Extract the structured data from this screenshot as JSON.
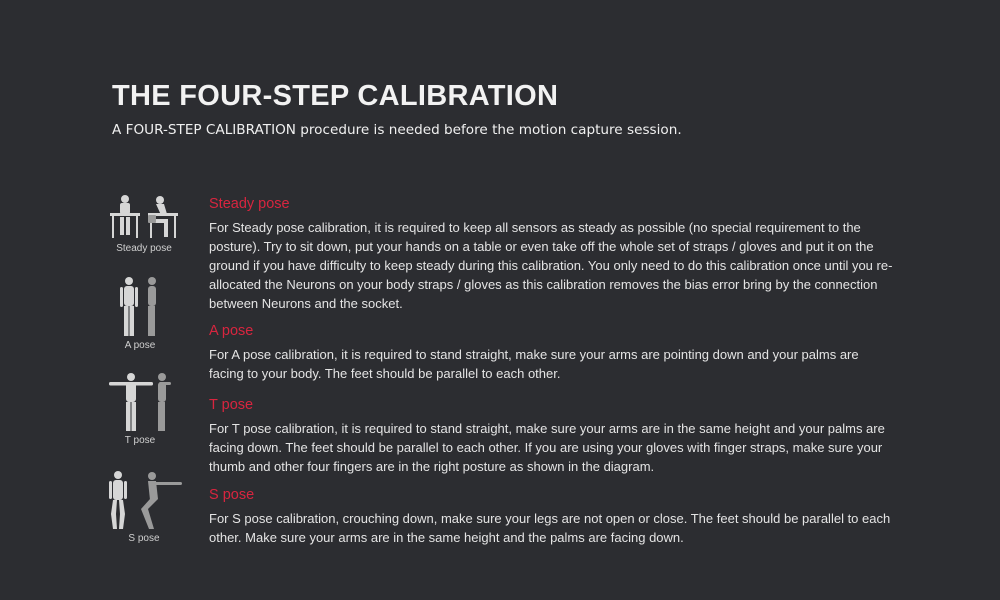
{
  "title": "THE FOUR-STEP CALIBRATION",
  "subtitle": "A FOUR-STEP CALIBRATION procedure is needed before the motion capture session.",
  "colors": {
    "background": "#2c2d31",
    "heading_accent": "#d8253f",
    "figure": "#c8c8c8"
  },
  "poses": [
    {
      "caption": "Steady pose",
      "heading": "Steady pose",
      "text": "For Steady pose calibration, it is required to keep all sensors as steady as possible (no special requirement to the posture). Try to sit down, put your hands on a table or even take off the whole set of straps / gloves and put it on the ground if you have difficulty to keep steady during this calibration. You only need to do this calibration once until you re-allocated the Neurons on your body straps / gloves as this calibration removes the bias error bring by the connection between Neurons and the socket."
    },
    {
      "caption": "A pose",
      "heading": "A pose",
      "text": "For A pose calibration, it is required to stand straight, make sure your arms are pointing down and your palms are facing to your body. The feet should be parallel to each other."
    },
    {
      "caption": "T pose",
      "heading": "T pose",
      "text": "For T pose calibration, it is required to stand straight, make sure your arms are in the same height and your palms are facing down. The feet should be parallel to each other. If you are using your gloves with finger straps, make sure your thumb and other four fingers are in the right posture as shown in the diagram."
    },
    {
      "caption": "S pose",
      "heading": "S pose",
      "text": "For S pose calibration, crouching down, make sure your legs are not open or close. The feet should be parallel to each other. Make sure your arms are in the same height and the palms are facing down."
    }
  ]
}
